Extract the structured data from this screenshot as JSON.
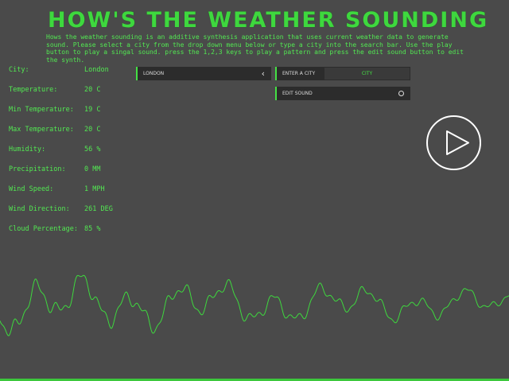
{
  "header": {
    "title": "HOW'S THE WEATHER SOUNDING",
    "description": "Hows the weather sounding is an additive synthesis application that uses current weather data to generate sound. Please select a city from the drop down menu below or type a city into the search bar. Use the play button to play a singal sound. press the 1,2,3 keys to play a pattern and press the edit sound button to edit the synth."
  },
  "stats": [
    {
      "label": "City:",
      "value": "London"
    },
    {
      "label": "Temperature:",
      "value": "20 C"
    },
    {
      "label": "Min Temperature:",
      "value": "19 C"
    },
    {
      "label": "Max Temperature:",
      "value": "20 C"
    },
    {
      "label": "Humidity:",
      "value": "56 %"
    },
    {
      "label": "Precipitation:",
      "value": "0 MM"
    },
    {
      "label": "Wind Speed:",
      "value": "1 MPH"
    },
    {
      "label": "Wind Direction:",
      "value": "261 DEG"
    },
    {
      "label": "Cloud Percentage:",
      "value": "85 %"
    }
  ],
  "controls": {
    "city_select_value": "LONDON",
    "city_search_label": "ENTER A CITY",
    "city_search_placeholder": "CITY",
    "edit_sound_label": "EDIT SOUND"
  },
  "colors": {
    "background": "#4a4a4a",
    "accent": "#44e044",
    "control_bg": "#2c2c2c"
  },
  "icons": {
    "city_select": "chevron-left-icon",
    "edit_sound": "circle-icon",
    "play": "play-icon"
  }
}
